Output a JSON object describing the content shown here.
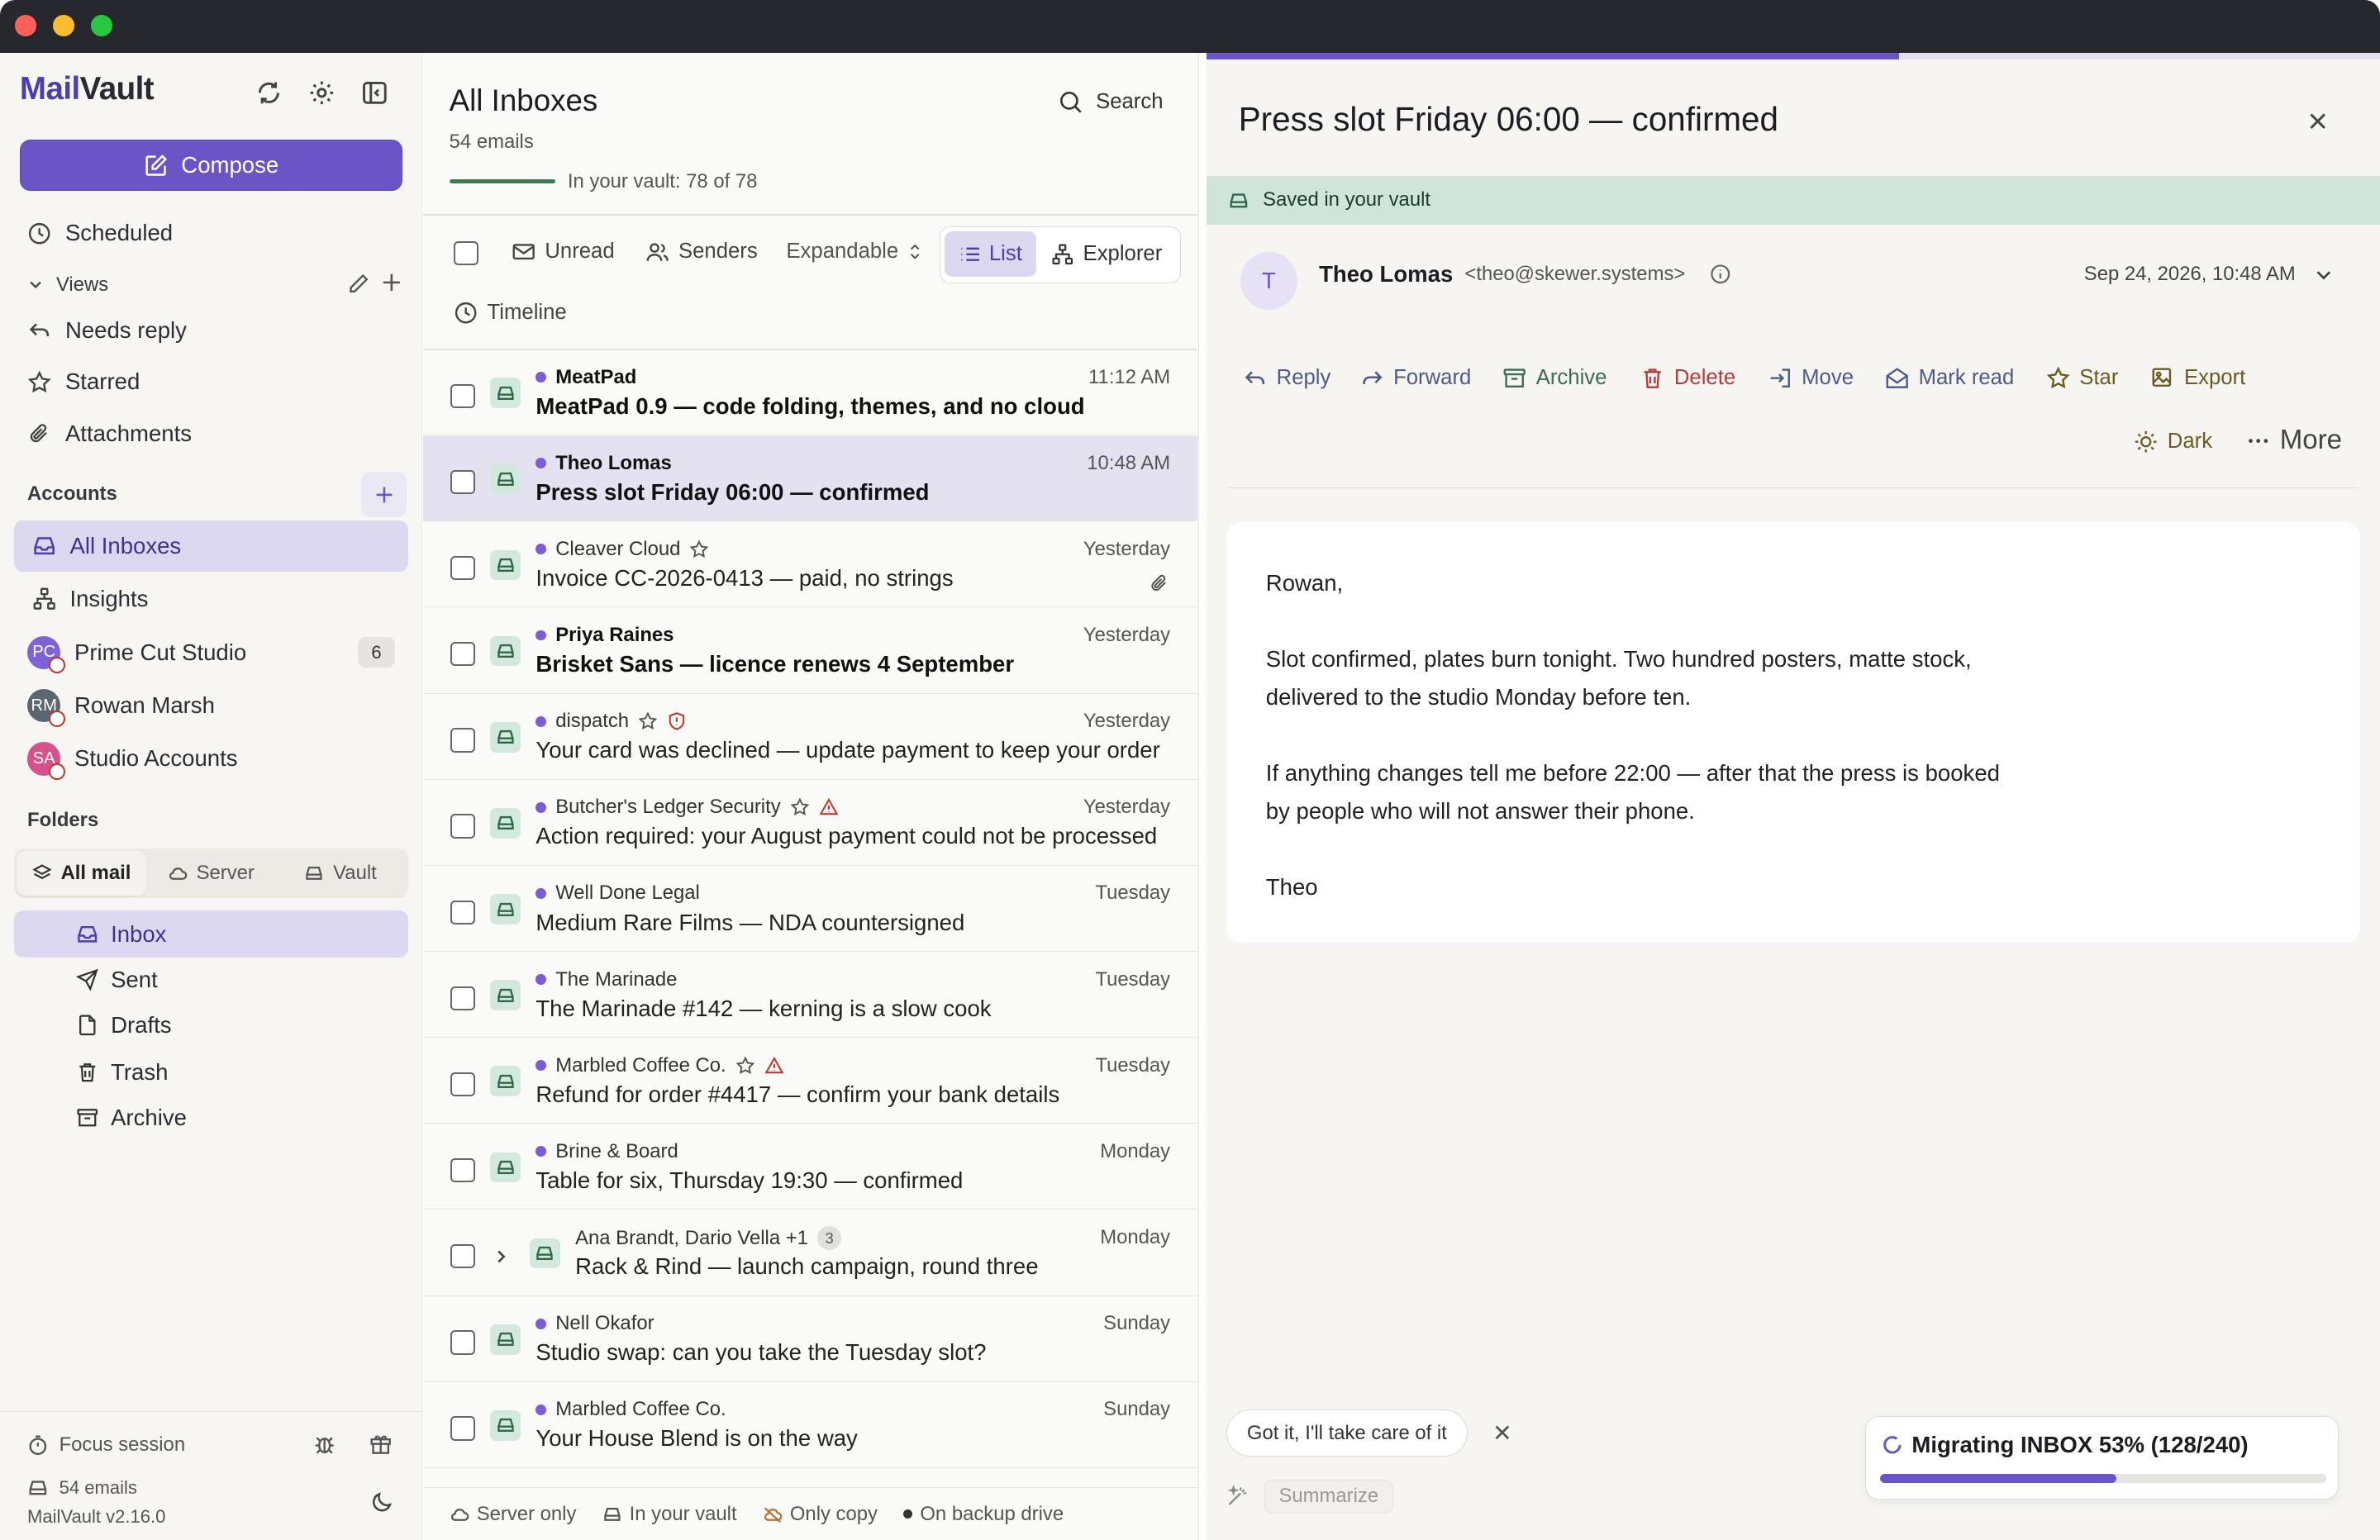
{
  "app": {
    "brand_prefix": "Mail",
    "brand_suffix": "Vault",
    "version": "MailVault v2.16.0"
  },
  "sidebar": {
    "compose_label": "Compose",
    "scheduled": "Scheduled",
    "views_label": "Views",
    "views": [
      "Needs reply",
      "Starred",
      "Attachments"
    ],
    "accounts_label": "Accounts",
    "all_inboxes": "All Inboxes",
    "insights": "Insights",
    "accounts": [
      {
        "initials": "PC",
        "name": "Prime Cut Studio",
        "count": "6",
        "color": "#7e63d8"
      },
      {
        "initials": "RM",
        "name": "Rowan Marsh",
        "color": "#5c6670"
      },
      {
        "initials": "SA",
        "name": "Studio Accounts",
        "color": "#d7518a"
      }
    ],
    "folders_label": "Folders",
    "folder_tabs": [
      "All mail",
      "Server",
      "Vault"
    ],
    "folders": [
      "Inbox",
      "Sent",
      "Drafts",
      "Trash",
      "Archive"
    ],
    "focus_session": "Focus session",
    "email_count": "54 emails"
  },
  "list": {
    "title": "All Inboxes",
    "subtitle": "54 emails",
    "vault_status": "In your vault: 78 of 78",
    "search_label": "Search",
    "filters": {
      "unread": "Unread",
      "senders": "Senders",
      "expandable": "Expandable",
      "list": "List",
      "explorer": "Explorer",
      "timeline": "Timeline"
    },
    "rows": [
      {
        "sender": "MeatPad",
        "subject": "MeatPad 0.9 — code folding, themes, and no cloud",
        "time": "11:12 AM",
        "unread": true
      },
      {
        "sender": "Theo Lomas",
        "subject": "Press slot Friday 06:00 — confirmed",
        "time": "10:48 AM",
        "unread": true,
        "selected": true
      },
      {
        "sender": "Cleaver Cloud",
        "subject": "Invoice CC-2026-0413 — paid, no strings",
        "time": "Yesterday",
        "unread": false,
        "star": true,
        "clip": true
      },
      {
        "sender": "Priya Raines",
        "subject": "Brisket Sans — licence renews 4 September",
        "time": "Yesterday",
        "unread": true
      },
      {
        "sender": "dispatch",
        "subject": "Your card was declined — update payment to keep your order",
        "time": "Yesterday",
        "unread": false,
        "star": true,
        "shield": true
      },
      {
        "sender": "Butcher's Ledger Security",
        "subject": "Action required: your August payment could not be processed",
        "time": "Yesterday",
        "unread": false,
        "star": true,
        "warn": true
      },
      {
        "sender": "Well Done Legal",
        "subject": "Medium Rare Films — NDA countersigned",
        "time": "Tuesday",
        "unread": false
      },
      {
        "sender": "The Marinade",
        "subject": "The Marinade #142 — kerning is a slow cook",
        "time": "Tuesday",
        "unread": false
      },
      {
        "sender": "Marbled Coffee Co.",
        "subject": "Refund for order #4417 — confirm your bank details",
        "time": "Tuesday",
        "unread": false,
        "star": true,
        "warn": true
      },
      {
        "sender": "Brine & Board",
        "subject": "Table for six, Thursday 19:30 — confirmed",
        "time": "Monday",
        "unread": false
      },
      {
        "sender": "Ana Brandt, Dario Vella +1",
        "subject": "Rack & Rind — launch campaign, round three",
        "time": "Monday",
        "unread": false,
        "thread": "3"
      },
      {
        "sender": "Nell Okafor",
        "subject": "Studio swap: can you take the Tuesday slot?",
        "time": "Sunday",
        "unread": false
      },
      {
        "sender": "Marbled Coffee Co.",
        "subject": "Your House Blend is on the way",
        "time": "Sunday",
        "unread": false
      }
    ],
    "legend": [
      "Server only",
      "In your vault",
      "Only copy",
      "On backup drive"
    ]
  },
  "reader": {
    "title": "Press slot Friday 06:00 — confirmed",
    "saved_banner": "Saved in your vault",
    "avatar_initial": "T",
    "from_name": "Theo Lomas",
    "from_email": "<theo@skewer.systems>",
    "date": "Sep 24, 2026, 10:48 AM",
    "actions": {
      "reply": "Reply",
      "forward": "Forward",
      "archive": "Archive",
      "delete": "Delete",
      "move": "Move",
      "mark_read": "Mark read",
      "star": "Star",
      "export": "Export",
      "dark": "Dark",
      "more": "More"
    },
    "body": {
      "greeting": "Rowan,",
      "para1a": "Slot confirmed, plates burn tonight. Two hundred posters, matte stock,",
      "para1b": "delivered to the studio Monday before ten.",
      "para2a": "If anything changes tell me before 22:00 — after that the press is booked",
      "para2b": "by people who will not answer their phone.",
      "signoff": "Theo"
    },
    "suggestion": "Got it, I'll take care of it",
    "summarize": "Summarize",
    "migration": {
      "label": "Migrating INBOX 53% (128/240)",
      "fraction": 0.53
    },
    "reading_progress": 0.59
  },
  "colors": {
    "accent": "#6b54c6",
    "vault": "#2f6a48",
    "danger": "#b23b3b"
  }
}
